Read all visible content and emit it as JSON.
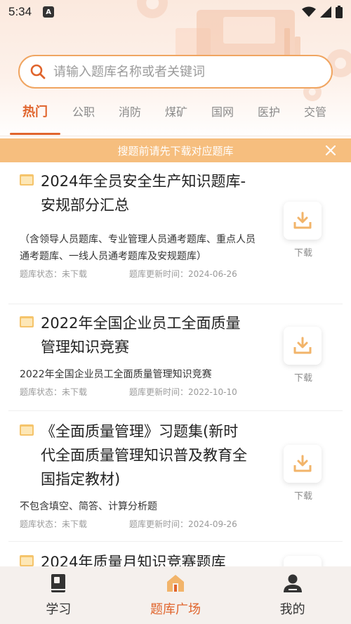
{
  "status_bar": {
    "time": "5:34",
    "badge": "A"
  },
  "search": {
    "placeholder": "请输入题库名称或者关键词"
  },
  "tabs": [
    {
      "label": "热门"
    },
    {
      "label": "公职"
    },
    {
      "label": "消防"
    },
    {
      "label": "煤矿"
    },
    {
      "label": "国网"
    },
    {
      "label": "医护"
    },
    {
      "label": "交管"
    }
  ],
  "notice": {
    "text": "搜题前请先下载对应题库"
  },
  "items": [
    {
      "title": "2024年全员安全生产知识题库-安规部分汇总",
      "description": "（含领导人员题库、专业管理人员通考题库、重点人员通考题库、一线人员通考题库及安规题库）",
      "status": "题库状态：未下载",
      "updated": "题库更新时间：2024-06-26",
      "download_label": "下载"
    },
    {
      "title": "2022年全国企业员工全面质量管理知识竞赛",
      "description": "2022年全国企业员工全面质量管理知识竞赛",
      "status": "题库状态：未下载",
      "updated": "题库更新时间：2022-10-10",
      "download_label": "下载"
    },
    {
      "title": "《全面质量管理》习题集(新时代全面质量管理知识普及教育全国指定教材)",
      "description": "不包含填空、简答、计算分析题",
      "status": "题库状态：未下载",
      "updated": "题库更新时间：2024-09-26",
      "download_label": "下载"
    },
    {
      "title": "2024年质量月知识竞赛题库"
    }
  ],
  "bottom_nav": [
    {
      "label": "学习",
      "icon": "book-icon"
    },
    {
      "label": "题库广场",
      "icon": "home-icon"
    },
    {
      "label": "我的",
      "icon": "person-icon"
    }
  ],
  "colors": {
    "accent": "#e0642c",
    "notice_bg": "#f6be7e",
    "search_border": "#f0a561"
  }
}
